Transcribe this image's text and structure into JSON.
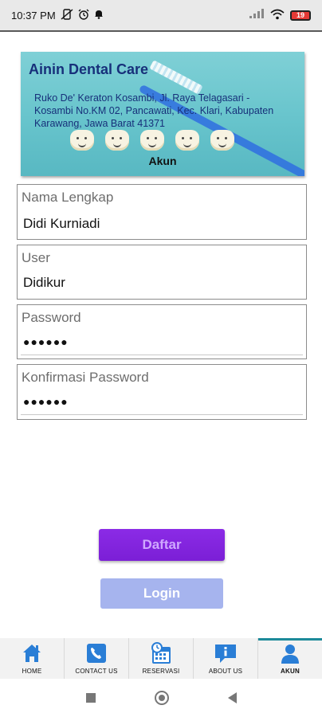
{
  "status_bar": {
    "time": "10:37 PM",
    "left_icons": [
      "no-vibrate-icon",
      "alarm-icon",
      "notification-bell-icon"
    ],
    "right_icons": [
      "cell-signal-icon",
      "wifi-icon",
      "battery-icon"
    ],
    "battery_level": "19"
  },
  "banner": {
    "title": "Ainin Dental Care",
    "address": "Ruko De' Keraton Kosambi, Jl. Raya Telagasari - Kosambi No.KM 02, Pancawati, Kec. Klari, Kabupaten Karawang, Jawa Barat 41371",
    "label": "Akun"
  },
  "form": {
    "full_name": {
      "label": "Nama Lengkap",
      "value": "Didi Kurniadi"
    },
    "user": {
      "label": "User",
      "value": "Didikur"
    },
    "password": {
      "label": "Password",
      "value": "●●●●●●"
    },
    "confirm_password": {
      "label": "Konfirmasi Password",
      "value": "●●●●●●"
    }
  },
  "buttons": {
    "register": "Daftar",
    "login": "Login"
  },
  "bottom_nav": {
    "items": [
      {
        "label": "HOME",
        "icon": "home-icon"
      },
      {
        "label": "CONTACT US",
        "icon": "phone-icon"
      },
      {
        "label": "RESERVASI",
        "icon": "calendar-clock-icon"
      },
      {
        "label": "ABOUT US",
        "icon": "info-chat-icon"
      },
      {
        "label": "AKUN",
        "icon": "user-icon"
      }
    ],
    "active": "AKUN"
  },
  "colors": {
    "accent_teal": "#1d8a9a",
    "primary_blue": "#2a7ed6",
    "register_purple": "#7b1fd6",
    "login_disabled": "#a6b4ee",
    "banner_text": "#17307a"
  }
}
